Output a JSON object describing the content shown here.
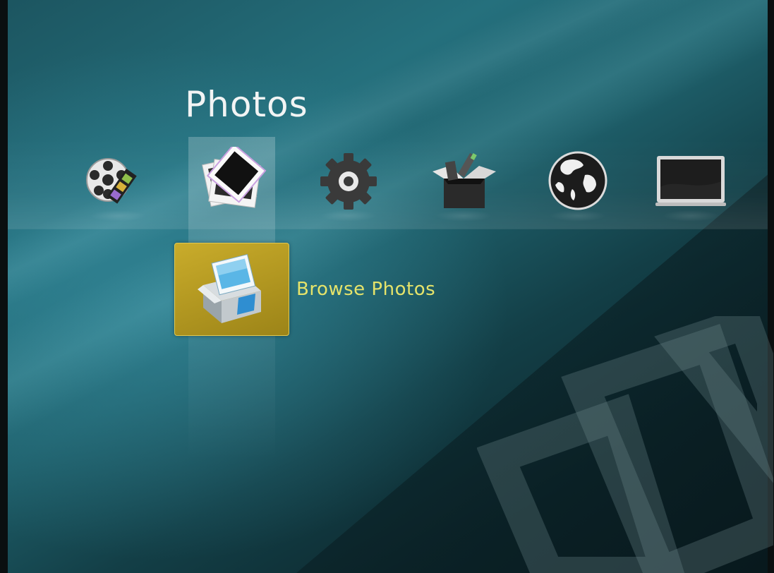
{
  "header": {
    "title": "Photos"
  },
  "icon_bar": {
    "items": [
      {
        "id": "video",
        "icon": "film-reel-icon",
        "selected": false
      },
      {
        "id": "photos",
        "icon": "photo-stack-icon",
        "selected": true
      },
      {
        "id": "settings",
        "icon": "gear-icon",
        "selected": false
      },
      {
        "id": "apps",
        "icon": "open-box-icon",
        "selected": false
      },
      {
        "id": "internet",
        "icon": "globe-icon",
        "selected": false
      },
      {
        "id": "tv",
        "icon": "monitor-icon",
        "selected": false
      }
    ]
  },
  "submenu": {
    "items": [
      {
        "label": "Browse Photos",
        "icon": "photo-box-icon",
        "focused": true
      }
    ]
  },
  "colors": {
    "background_accent": "#25707d",
    "focus_tile": "#c9ac2b",
    "focus_label": "#e5e36a",
    "title_text": "#f2f4f4"
  }
}
